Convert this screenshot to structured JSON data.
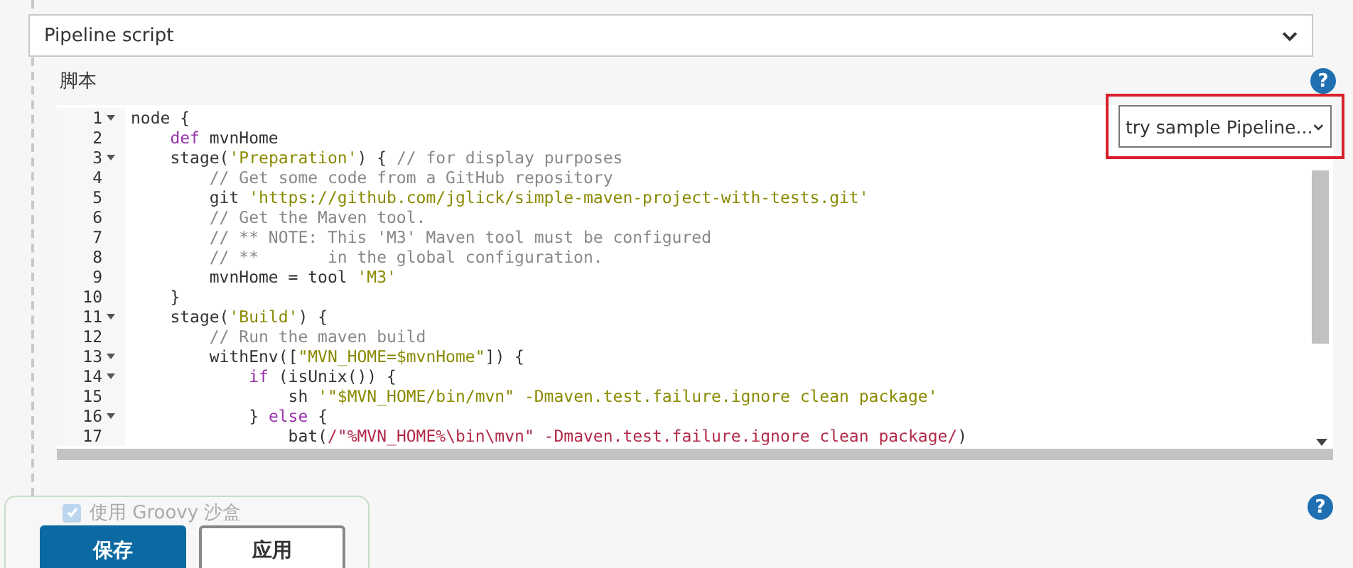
{
  "definition_select": {
    "value": "Pipeline script"
  },
  "script_label": "脚本",
  "script_help": "?",
  "editor": {
    "lines": [
      {
        "number": "1",
        "foldable": true,
        "tokens": [
          {
            "kind": "plain",
            "text": "node {"
          }
        ]
      },
      {
        "number": "2",
        "foldable": false,
        "tokens": [
          {
            "kind": "keyword",
            "text": "    def"
          },
          {
            "kind": "plain",
            "text": " mvnHome"
          }
        ]
      },
      {
        "number": "3",
        "foldable": true,
        "tokens": [
          {
            "kind": "plain",
            "text": "    stage("
          },
          {
            "kind": "string",
            "text": "'Preparation'"
          },
          {
            "kind": "plain",
            "text": ") { "
          },
          {
            "kind": "comment",
            "text": "// for display purposes"
          }
        ]
      },
      {
        "number": "4",
        "foldable": false,
        "tokens": [
          {
            "kind": "comment",
            "text": "        // Get some code from a GitHub repository"
          }
        ]
      },
      {
        "number": "5",
        "foldable": false,
        "tokens": [
          {
            "kind": "plain",
            "text": "        git "
          },
          {
            "kind": "string",
            "text": "'https://github.com/jglick/simple-maven-project-with-tests.git'"
          }
        ]
      },
      {
        "number": "6",
        "foldable": false,
        "tokens": [
          {
            "kind": "comment",
            "text": "        // Get the Maven tool."
          }
        ]
      },
      {
        "number": "7",
        "foldable": false,
        "tokens": [
          {
            "kind": "comment",
            "text": "        // ** NOTE: This 'M3' Maven tool must be configured"
          }
        ]
      },
      {
        "number": "8",
        "foldable": false,
        "tokens": [
          {
            "kind": "comment",
            "text": "        // **       in the global configuration."
          }
        ]
      },
      {
        "number": "9",
        "foldable": false,
        "tokens": [
          {
            "kind": "plain",
            "text": "        mvnHome = tool "
          },
          {
            "kind": "string",
            "text": "'M3'"
          }
        ]
      },
      {
        "number": "10",
        "foldable": false,
        "tokens": [
          {
            "kind": "plain",
            "text": "    }"
          }
        ]
      },
      {
        "number": "11",
        "foldable": true,
        "tokens": [
          {
            "kind": "plain",
            "text": "    stage("
          },
          {
            "kind": "string",
            "text": "'Build'"
          },
          {
            "kind": "plain",
            "text": ") {"
          }
        ]
      },
      {
        "number": "12",
        "foldable": false,
        "tokens": [
          {
            "kind": "comment",
            "text": "        // Run the maven build"
          }
        ]
      },
      {
        "number": "13",
        "foldable": true,
        "tokens": [
          {
            "kind": "plain",
            "text": "        withEnv(["
          },
          {
            "kind": "string",
            "text": "\"MVN_HOME=$mvnHome\""
          },
          {
            "kind": "plain",
            "text": "]) {"
          }
        ]
      },
      {
        "number": "14",
        "foldable": true,
        "tokens": [
          {
            "kind": "keyword",
            "text": "            if"
          },
          {
            "kind": "plain",
            "text": " (isUnix()) {"
          }
        ]
      },
      {
        "number": "15",
        "foldable": false,
        "tokens": [
          {
            "kind": "plain",
            "text": "                sh "
          },
          {
            "kind": "string",
            "text": "'\"$MVN_HOME/bin/mvn\" -Dmaven.test.failure.ignore clean package'"
          }
        ]
      },
      {
        "number": "16",
        "foldable": true,
        "tokens": [
          {
            "kind": "plain",
            "text": "            } "
          },
          {
            "kind": "keyword",
            "text": "else"
          },
          {
            "kind": "plain",
            "text": " {"
          }
        ]
      },
      {
        "number": "17",
        "foldable": false,
        "tokens": [
          {
            "kind": "plain",
            "text": "                bat("
          },
          {
            "kind": "regex",
            "text": "/\"%MVN_HOME%\\bin\\mvn\" -Dmaven.test.failure.ignore clean package/"
          },
          {
            "kind": "plain",
            "text": ")"
          }
        ]
      }
    ]
  },
  "sample_select": {
    "value": "try sample Pipeline..."
  },
  "sandbox": {
    "label": "使用 Groovy 沙盒",
    "checked": true,
    "help": "?"
  },
  "buttons": [
    {
      "label": "保存",
      "kind": "primary"
    },
    {
      "label": "应用",
      "kind": "secondary"
    }
  ]
}
